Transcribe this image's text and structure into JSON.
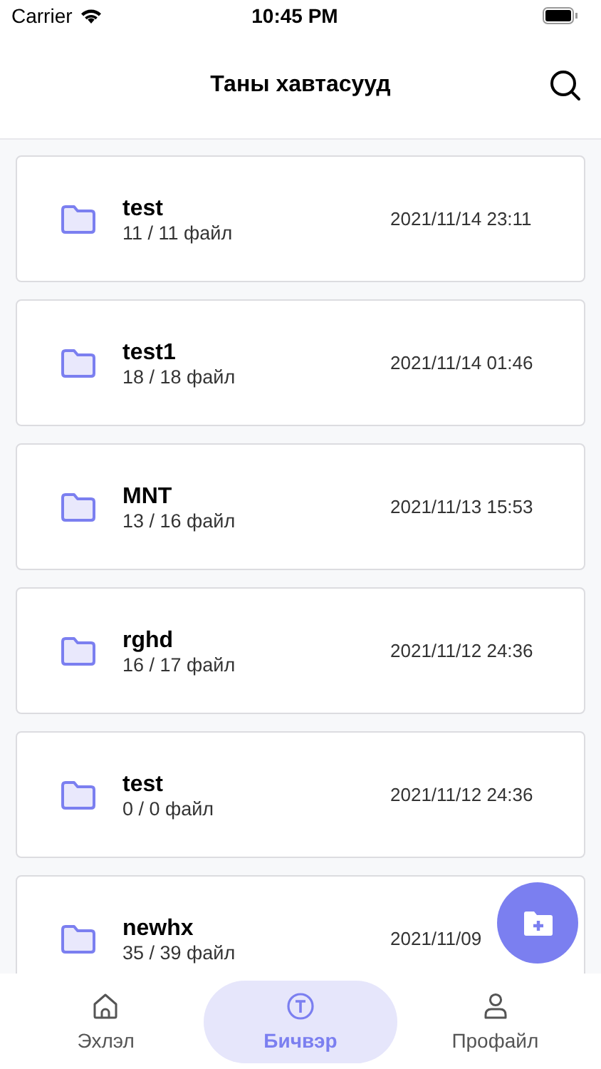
{
  "status_bar": {
    "carrier": "Carrier",
    "time": "10:45 PM"
  },
  "header": {
    "title": "Таны хавтасууд"
  },
  "folders": [
    {
      "name": "test",
      "count": "11 / 11 файл",
      "date": "2021/11/14 23:11"
    },
    {
      "name": "test1",
      "count": "18 / 18 файл",
      "date": "2021/11/14 01:46"
    },
    {
      "name": "MNT",
      "count": "13 / 16 файл",
      "date": "2021/11/13 15:53"
    },
    {
      "name": "rghd",
      "count": "16 / 17 файл",
      "date": "2021/11/12 24:36"
    },
    {
      "name": "test",
      "count": "0 / 0 файл",
      "date": "2021/11/12 24:36"
    },
    {
      "name": "newhx",
      "count": "35 / 39 файл",
      "date": "2021/11/09"
    }
  ],
  "tabs": [
    {
      "kind": "home",
      "label": "Эхлэл",
      "selected": false
    },
    {
      "kind": "write",
      "label": "Бичвэр",
      "selected": true
    },
    {
      "kind": "profile",
      "label": "Профайл",
      "selected": false
    }
  ]
}
